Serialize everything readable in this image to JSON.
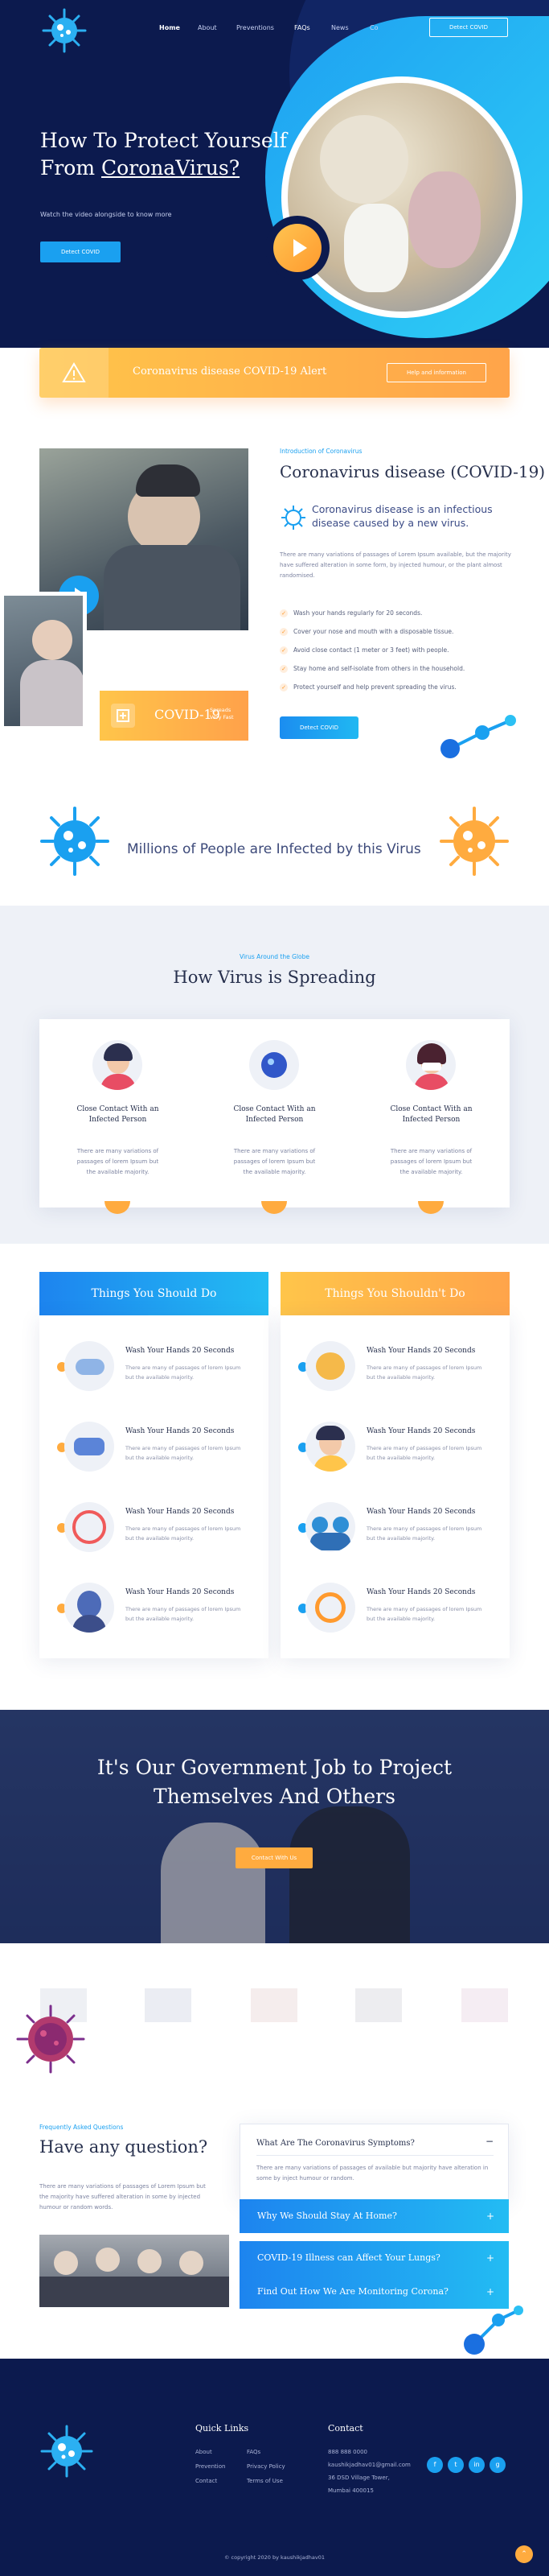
{
  "nav": {
    "items": [
      "Home",
      "About",
      "Preventions",
      "FAQs",
      "News",
      "Co"
    ],
    "cta": "Detect COVID"
  },
  "hero": {
    "title_line1": "How To Protect Yourself",
    "title_line2_prefix": "From ",
    "title_line2_accent": "CoronaVirus?",
    "subtitle": "Watch the video alongside to know more",
    "cta": "Detect COVID"
  },
  "alert": {
    "text": "Coronavirus disease COVID-19 Alert",
    "button": "Help and information"
  },
  "intro": {
    "eyebrow": "Introduction of Coronavirus",
    "title": "Coronavirus disease (COVID-19)",
    "lead": "Coronavirus disease is an infectious disease caused by a new virus.",
    "body": "There are many variations of passages of Lorem Ipsum available, but the majority have suffered alteration in some form, by injected humour, or the plant almost randomised.",
    "checks": [
      "Wash your hands regularly for 20 seconds.",
      "Cover your nose and mouth with a disposable tissue.",
      "Avoid close contact (1 meter or 3 feet) with people.",
      "Stay home and self-isolate from others in the household.",
      "Protect yourself and help prevent spreading the virus."
    ],
    "cta": "Detect COVID",
    "badge_title": "COVID-19",
    "badge_sub": "Spreads Very Fast"
  },
  "banner": {
    "text": "Millions of People are Infected by this Virus"
  },
  "spreading": {
    "eyebrow": "Virus Around the Globe",
    "title": "How Virus is Spreading",
    "cards": [
      {
        "title_l1": "Close Contact With an",
        "title_l2": "Infected Person",
        "desc": "There are many variations of passages of lorem Ipsum but the available majority."
      },
      {
        "title_l1": "Close Contact With an",
        "title_l2": "Infected Person",
        "desc": "There are many variations of passages of lorem Ipsum but the available majority."
      },
      {
        "title_l1": "Close Contact With an",
        "title_l2": "Infected Person",
        "desc": "There are many variations of passages of lorem Ipsum but the available majority."
      }
    ]
  },
  "dos": {
    "title": "Things You Should Do",
    "items": [
      {
        "title": "Wash Your Hands 20 Seconds",
        "desc": "There are many of passages of lorem Ipsum but the available majority."
      },
      {
        "title": "Wash Your Hands 20 Seconds",
        "desc": "There are many of passages of lorem Ipsum but the available majority."
      },
      {
        "title": "Wash Your Hands 20 Seconds",
        "desc": "There are many of passages of lorem Ipsum but the available majority."
      },
      {
        "title": "Wash Your Hands 20 Seconds",
        "desc": "There are many of passages of lorem Ipsum but the available majority."
      }
    ]
  },
  "donts": {
    "title": "Things You Shouldn't Do",
    "items": [
      {
        "title": "Wash Your Hands 20 Seconds",
        "desc": "There are many of passages of lorem Ipsum but the available majority."
      },
      {
        "title": "Wash Your Hands 20 Seconds",
        "desc": "There are many of passages of lorem Ipsum but the available majority."
      },
      {
        "title": "Wash Your Hands 20 Seconds",
        "desc": "There are many of passages of lorem Ipsum but the available majority."
      },
      {
        "title": "Wash Your Hands 20 Seconds",
        "desc": "There are many of passages of lorem Ipsum but the available majority."
      }
    ]
  },
  "government": {
    "line1": "It's Our Government Job to Project",
    "line2": "Themselves And Others",
    "cta": "Contact With Us"
  },
  "faq": {
    "eyebrow": "Frequently Asked Questions",
    "title": "Have any question?",
    "body": "There are many variations of passages of Lorem Ipsum but the majority have suffered alteration in some by injected humour or random words.",
    "open_question": "What Are The Coronavirus Symptoms?",
    "open_answer": "There are many variations of passages of available but majority have alteration in some by inject humour or random.",
    "questions": [
      "Why We Should Stay At Home?",
      "COVID-19 Illness can Affect Your Lungs?",
      "Find Out How We Are Monitoring Corona?"
    ]
  },
  "footer": {
    "quick_title": "Quick Links",
    "links_col1": [
      "About",
      "Prevention",
      "Contact"
    ],
    "links_col2": [
      "FAQs",
      "Privacy Policy",
      "Terms of Use"
    ],
    "contact_title": "Contact",
    "contact_lines": [
      "888 888 0000",
      "kaushikjadhav01@gmail.com",
      "36 DSD Village Tower,",
      "Mumbai 400015"
    ],
    "social": [
      "f",
      "t",
      "in",
      "g"
    ],
    "copyright": "© copyright 2020 by kaushikjadhav01"
  },
  "colors": {
    "navy": "#0c1a4e",
    "accent_blue": "#1aa0f0",
    "accent_orange": "#ffab3f"
  }
}
